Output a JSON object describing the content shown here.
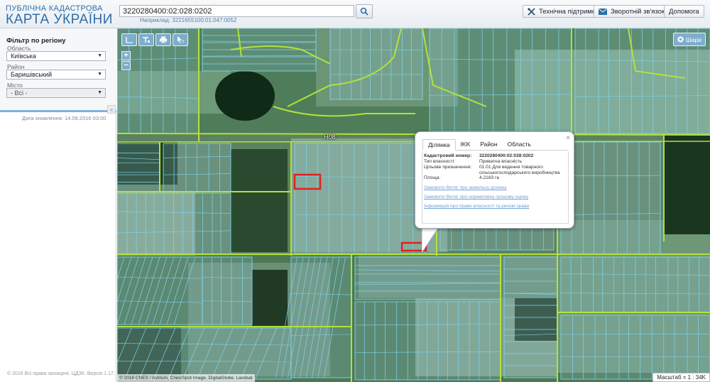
{
  "header": {
    "logo_line1": "ПУБЛІЧНА КАДАСТРОВА",
    "logo_line2": "КАРТА УКРАЇНИ",
    "search_value": "3220280400:02:028:0202",
    "search_hint": "Наприклад: 3221655100:01:047:0052",
    "buttons": {
      "support": "Технічна підтримка",
      "feedback": "Зворотній зв'язок",
      "help": "Допомога"
    }
  },
  "sidebar": {
    "filter_title": "Фільтр по регіону",
    "fields": [
      {
        "label": "Область",
        "value": "Київська"
      },
      {
        "label": "Район",
        "value": "Баришівський"
      },
      {
        "label": "Місто",
        "value": "- Всі -"
      }
    ],
    "collapse_symbol": "«",
    "update_date": "Дата оновлення: 14.09.2016 03:00",
    "copyright": "© 2016 Всі права захищені. ЦДЗК. Версія 1.17."
  },
  "map": {
    "layers_label": "Шари",
    "zoom_in": "+",
    "zoom_out": "−",
    "road_label": "Н08",
    "attribution": "© 2016 CNES / Astrium, Cnes/Spot Image, DigitalGlobe, Landsat",
    "scale": "Масштаб = 1 : 34K",
    "tool_icons": [
      "measure-length-icon",
      "measure-area-icon",
      "print-icon",
      "pointer-help-icon"
    ]
  },
  "popup": {
    "close_symbol": "×",
    "tabs": [
      "Ділянка",
      "IKK",
      "Район",
      "Область"
    ],
    "active_tab": "Ділянка",
    "rows": [
      {
        "key": "Кадастровий номер:",
        "value": "3220280400:02:028:0202"
      },
      {
        "key": "Тип власності:",
        "value": "Приватна власність"
      },
      {
        "key": "Цільове призначення:",
        "value": "01.01 Для ведення товарного сільськогосподарського виробництва"
      },
      {
        "key": "Площа:",
        "value": "4.2183 га"
      }
    ],
    "links": [
      "Замовити Витяг про земельну ділянку",
      "Замовити Витяг про нормативну грошову оцінку",
      "Інформація про право власності та речові права"
    ]
  },
  "colors": {
    "accent": "#2d6ea8",
    "parcel_border": "#7fd6f0",
    "region_border": "#b3e23a",
    "selected_parcel": "#e02020"
  }
}
